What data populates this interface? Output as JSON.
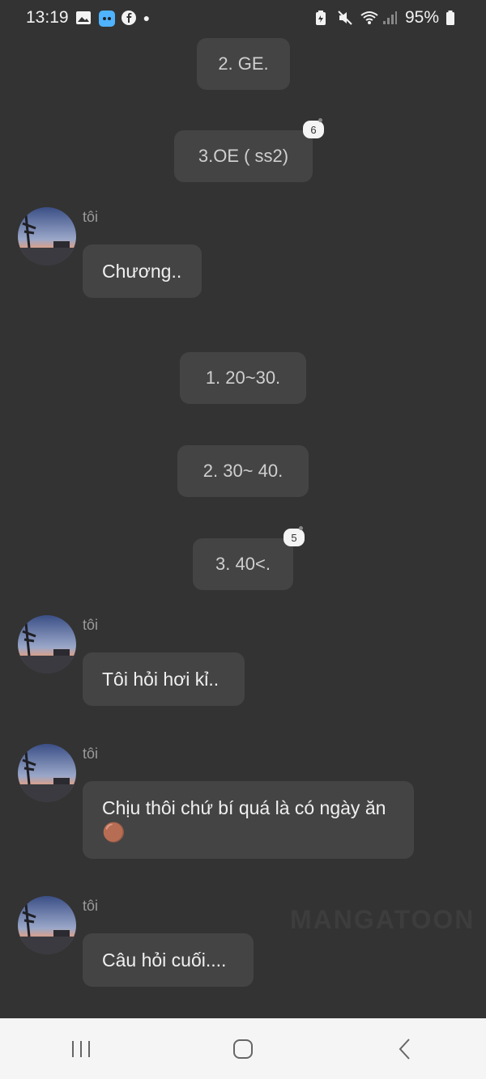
{
  "status": {
    "time": "13:19",
    "battery": "95%"
  },
  "messages_center": [
    {
      "text": "2. GE."
    },
    {
      "text": "3.OE ( ss2)",
      "badge": "6"
    },
    {
      "text": "1. 20~30."
    },
    {
      "text": "2. 30~ 40."
    },
    {
      "text": "3. 40<.",
      "badge": "5"
    }
  ],
  "chat": [
    {
      "sender": "tôi",
      "text": "Chương.."
    },
    {
      "sender": "tôi",
      "text": "Tôi hỏi hơi kỉ.."
    },
    {
      "sender": "tôi",
      "text": "Chịu thôi chứ bí quá là có ngày ăn 🟤"
    },
    {
      "sender": "tôi",
      "text": "Câu hỏi cuối...."
    }
  ],
  "watermark": "MANGATOON",
  "colors": {
    "background": "#333333",
    "bubble": "#444444",
    "navbar": "#f5f5f5"
  }
}
